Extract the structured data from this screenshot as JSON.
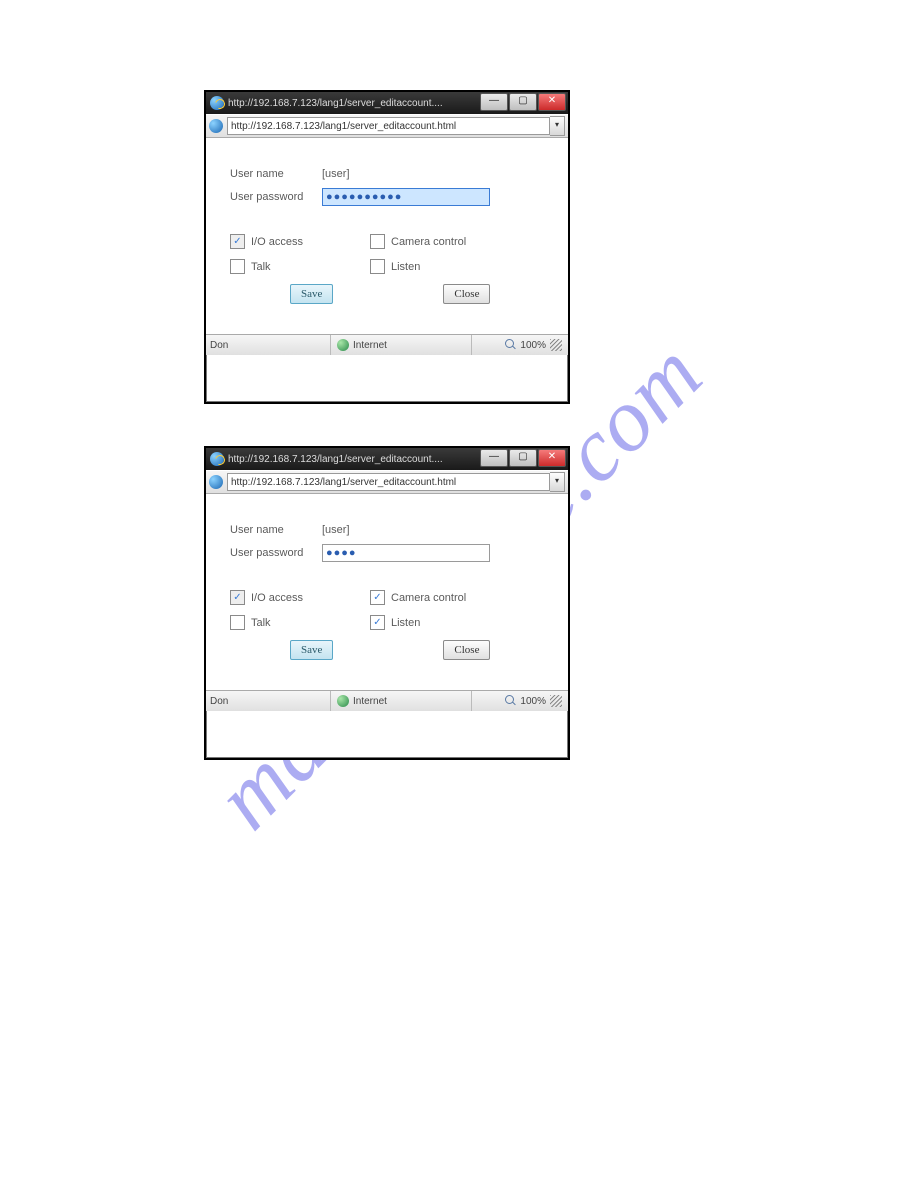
{
  "watermark": "manualshive.com",
  "labels": {
    "username": "User name",
    "password": "User password",
    "io_access": "I/O access",
    "camera_control": "Camera control",
    "talk": "Talk",
    "listen": "Listen",
    "save": "Save",
    "close": "Close"
  },
  "status": {
    "left": "Don",
    "zone": "Internet",
    "zoom": "100%"
  },
  "dialogs": [
    {
      "title": "http://192.168.7.123/lang1/server_editaccount....",
      "url": "http://192.168.7.123/lang1/server_editaccount.html",
      "username": "[user]",
      "password_mask": "●●●●●●●●●●",
      "checks": {
        "io_access": true,
        "camera_control": false,
        "talk": false,
        "listen": false
      }
    },
    {
      "title": "http://192.168.7.123/lang1/server_editaccount....",
      "url": "http://192.168.7.123/lang1/server_editaccount.html",
      "username": "[user]",
      "password_mask": "●●●●",
      "checks": {
        "io_access": true,
        "camera_control": true,
        "talk": false,
        "listen": true
      }
    }
  ]
}
